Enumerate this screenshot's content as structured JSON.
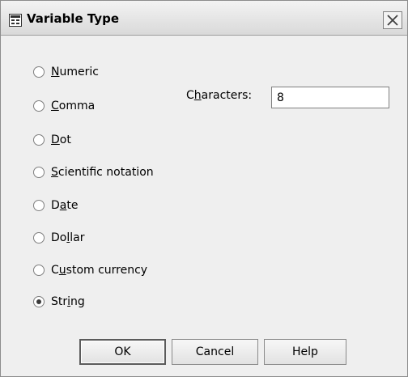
{
  "dialog": {
    "title": "Variable Type",
    "close_icon": "close-icon",
    "window_icon": "spss-window-icon"
  },
  "types": {
    "selected": "String",
    "options": [
      {
        "label": "Numeric",
        "pre": "",
        "mnemonic": "N",
        "post": "umeric"
      },
      {
        "label": "Comma",
        "pre": "",
        "mnemonic": "C",
        "post": "omma"
      },
      {
        "label": "Dot",
        "pre": "",
        "mnemonic": "D",
        "post": "ot"
      },
      {
        "label": "Scientific notation",
        "pre": "",
        "mnemonic": "S",
        "post": "cientific notation"
      },
      {
        "label": "Date",
        "pre": "D",
        "mnemonic": "a",
        "post": "te"
      },
      {
        "label": "Dollar",
        "pre": "Do",
        "mnemonic": "l",
        "post": "lar"
      },
      {
        "label": "Custom currency",
        "pre": "C",
        "mnemonic": "u",
        "post": "stom currency"
      },
      {
        "label": "String",
        "pre": "Str",
        "mnemonic": "i",
        "post": "ng"
      }
    ]
  },
  "characters": {
    "label_pre": "C",
    "label_mnemonic": "h",
    "label_post": "aracters:",
    "value": "8"
  },
  "buttons": {
    "ok": "OK",
    "cancel": "Cancel",
    "help": "Help"
  }
}
